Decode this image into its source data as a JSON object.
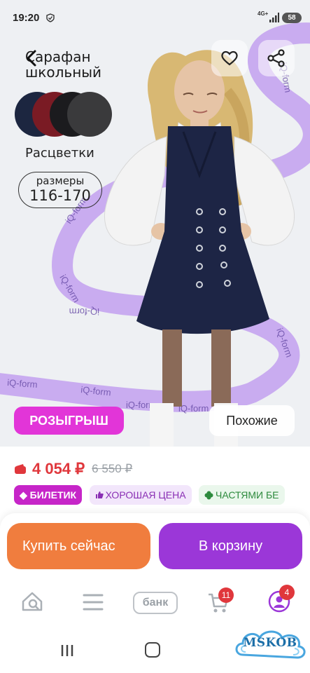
{
  "status_bar": {
    "time": "19:20",
    "network": "4G+",
    "battery": "58"
  },
  "product": {
    "title_line1": "Сарафан",
    "title_line2": "школьный",
    "colors_label": "Расцветки",
    "sizes_label": "размеры",
    "sizes_range": "116-170",
    "brand_ribbon_text": "iQ-form",
    "swatch_colors": [
      "#1c2640",
      "#7a1b24",
      "#1b1b1e",
      "#3a3a3c"
    ]
  },
  "hero_buttons": {
    "giveaway": "РОЗЫГРЫШ",
    "similar": "Похожие"
  },
  "price": {
    "current": "4 054 ₽",
    "old": "6 550 ₽"
  },
  "badges": [
    {
      "label": "◆ БИЛЕТИК"
    },
    {
      "label": "ХОРОШАЯ ЦЕНА"
    },
    {
      "label": "ЧАСТЯМИ БЕ"
    }
  ],
  "actions": {
    "buy_now": "Купить сейчас",
    "add_to_cart": "В корзину"
  },
  "bottom_nav": {
    "bank_label": "банк",
    "cart_count": "11",
    "profile_count": "4"
  },
  "watermark": "MSKOB",
  "colors": {
    "accent_purple": "#9b37d8",
    "accent_orange": "#f07d3e",
    "price_red": "#e0373c",
    "giveaway_pink": "#e235d8",
    "ribbon_lavender": "#c6a8ef"
  }
}
